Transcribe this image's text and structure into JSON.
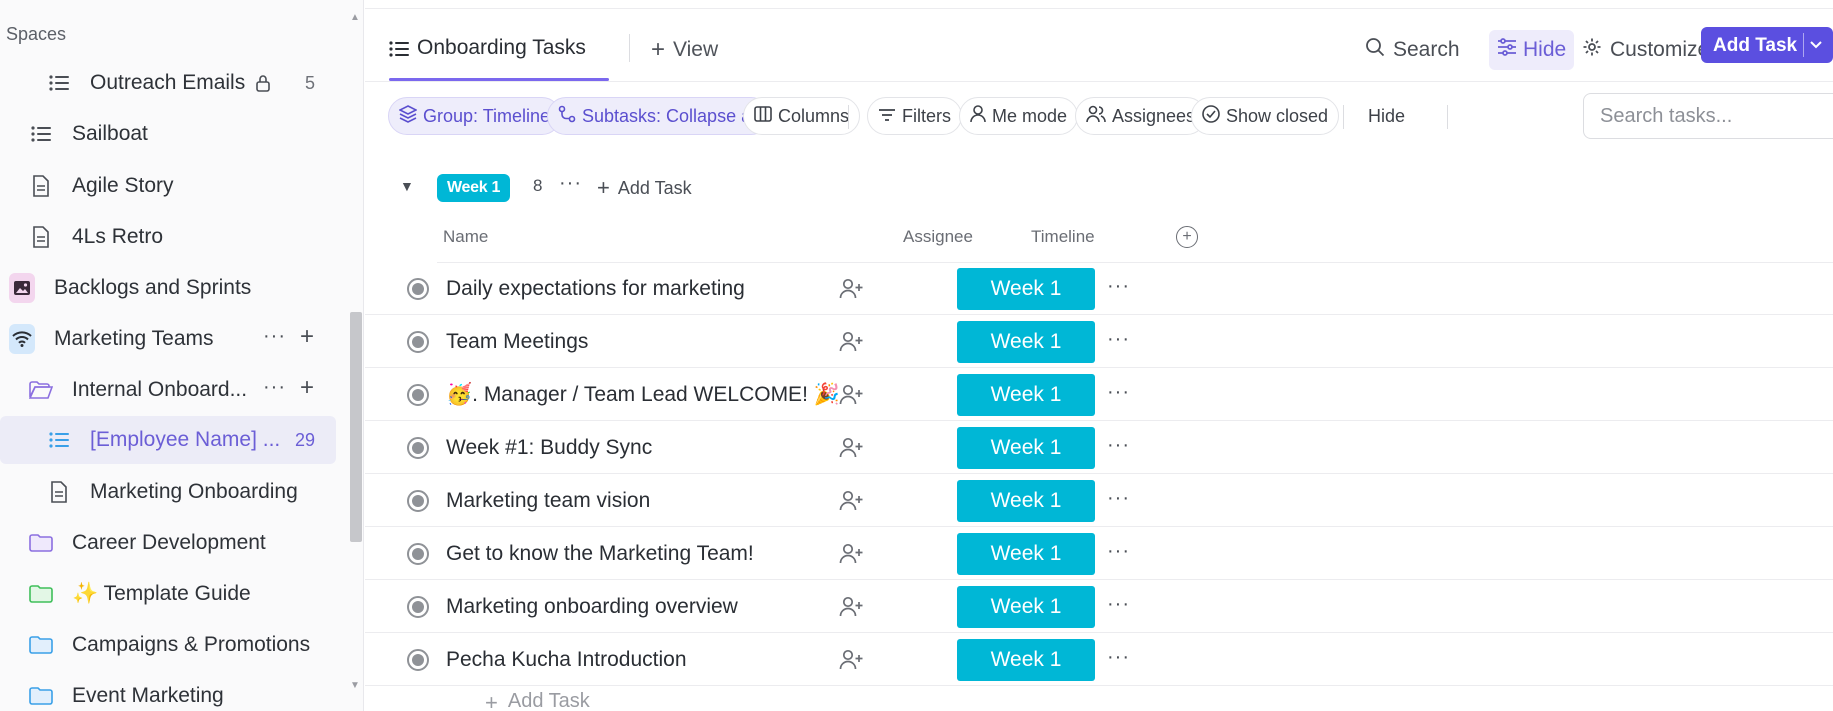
{
  "sidebar": {
    "section_label": "Spaces",
    "items": [
      {
        "label": "Outreach Emails",
        "count": "5",
        "icon": "list-icon",
        "locked": true
      },
      {
        "label": "Sailboat",
        "icon": "list-icon"
      },
      {
        "label": "Agile Story",
        "icon": "doc-icon"
      },
      {
        "label": "4Ls Retro",
        "icon": "doc-icon"
      },
      {
        "label": "Backlogs and Sprints",
        "icon": "image-space-icon"
      },
      {
        "label": "Marketing Teams",
        "icon": "wifi-space-icon"
      },
      {
        "label": "Internal Onboard...",
        "icon": "folder-open-icon"
      },
      {
        "label": "[Employee Name] ...",
        "count": "29",
        "icon": "list-icon"
      },
      {
        "label": "Marketing Onboarding",
        "icon": "doc-icon"
      },
      {
        "label": "Career Development",
        "icon": "folder-icon"
      },
      {
        "label": "✨ Template Guide",
        "icon": "folder-icon"
      },
      {
        "label": "Campaigns & Promotions",
        "icon": "folder-icon"
      },
      {
        "label": "Event Marketing",
        "icon": "folder-icon"
      }
    ]
  },
  "header": {
    "tab_active": "Onboarding Tasks",
    "tab_add_view": "View",
    "search": "Search",
    "hide": "Hide",
    "customize": "Customize",
    "add_task": "Add Task"
  },
  "filters": {
    "group": "Group: Timeline",
    "subtasks": "Subtasks: Collapse all",
    "columns": "Columns",
    "filters": "Filters",
    "me_mode": "Me mode",
    "assignees": "Assignees",
    "show_closed": "Show closed",
    "hide": "Hide",
    "search_placeholder": "Search tasks..."
  },
  "group": {
    "label": "Week 1",
    "count": "8",
    "add_task": "Add Task"
  },
  "columns": {
    "name": "Name",
    "assignee": "Assignee",
    "timeline": "Timeline"
  },
  "tasks": [
    {
      "name": "Daily expectations for marketing",
      "timeline": "Week 1"
    },
    {
      "name": "Team Meetings",
      "timeline": "Week 1"
    },
    {
      "name": "🥳. Manager / Team Lead WELCOME! 🎉",
      "timeline": "Week 1"
    },
    {
      "name": "Week #1: Buddy Sync",
      "timeline": "Week 1"
    },
    {
      "name": "Marketing team vision",
      "timeline": "Week 1"
    },
    {
      "name": "Get to know the Marketing Team!",
      "timeline": "Week 1"
    },
    {
      "name": "Marketing onboarding overview",
      "timeline": "Week 1"
    },
    {
      "name": "Pecha Kucha Introduction",
      "timeline": "Week 1"
    }
  ],
  "footer": {
    "add_task": "Add Task"
  },
  "colors": {
    "accent": "#7b68ee",
    "timeline": "#00b7d6",
    "primary_button": "#5b4fe0"
  }
}
